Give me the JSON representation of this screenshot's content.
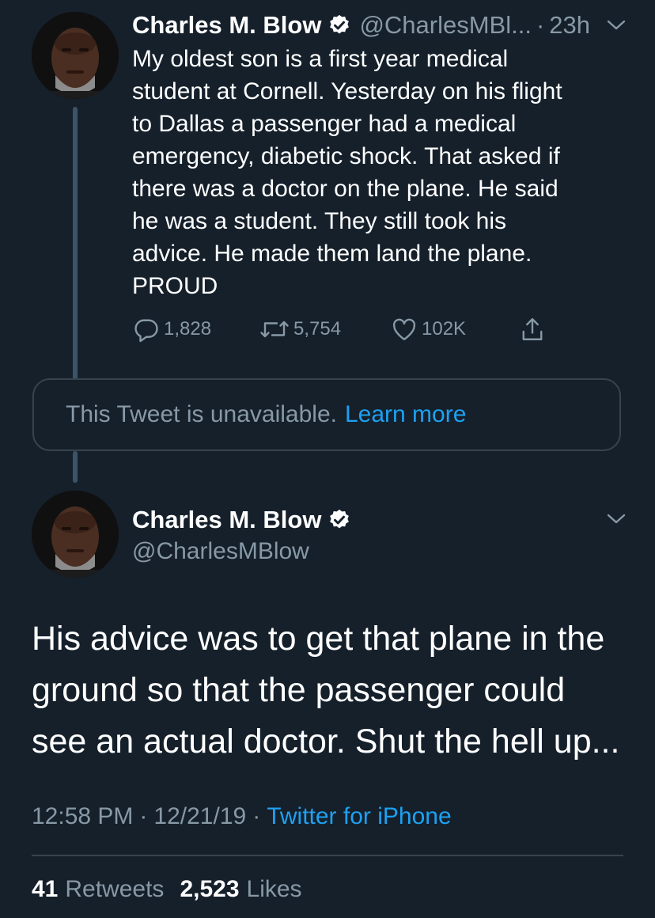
{
  "colors": {
    "background": "#15202b",
    "text": "#ffffff",
    "muted": "#8899a6",
    "accent": "#1da1f2",
    "border": "#38444d"
  },
  "parent_tweet": {
    "author_name": "Charles M. Blow",
    "handle": "@CharlesMBl...",
    "separator": "·",
    "time": "23h",
    "text": "My oldest son is a first year medical\nstudent at Cornell. Yesterday on his flight\nto Dallas a passenger had a medical\nemergency, diabetic shock. That asked if\nthere was a doctor on the plane. He said\nhe was a student. They still took his\nadvice. He made them land the plane.\nPROUD",
    "icons": {
      "avatar": "avatar-photo",
      "verified": "verified-badge-icon",
      "menu": "chevron-down-icon",
      "reply": "reply-icon",
      "retweet": "retweet-icon",
      "like": "heart-icon",
      "share": "share-icon"
    },
    "reply_count": "1,828",
    "retweet_count": "5,754",
    "like_count": "102K"
  },
  "unavailable_card": {
    "message": "This Tweet is unavailable.",
    "link_text": "Learn more"
  },
  "main_tweet": {
    "author_name": "Charles M. Blow",
    "handle": "@CharlesMBlow",
    "text": "His advice was to get that plane in the\nground so that the passenger could\nsee an actual doctor. Shut the hell up...",
    "time": "12:58 PM",
    "separator": "·",
    "date": "12/21/19",
    "separator2": "·",
    "source": "Twitter for iPhone",
    "retweets_count": "41",
    "retweets_label": "Retweets",
    "likes_count": "2,523",
    "likes_label": "Likes"
  }
}
